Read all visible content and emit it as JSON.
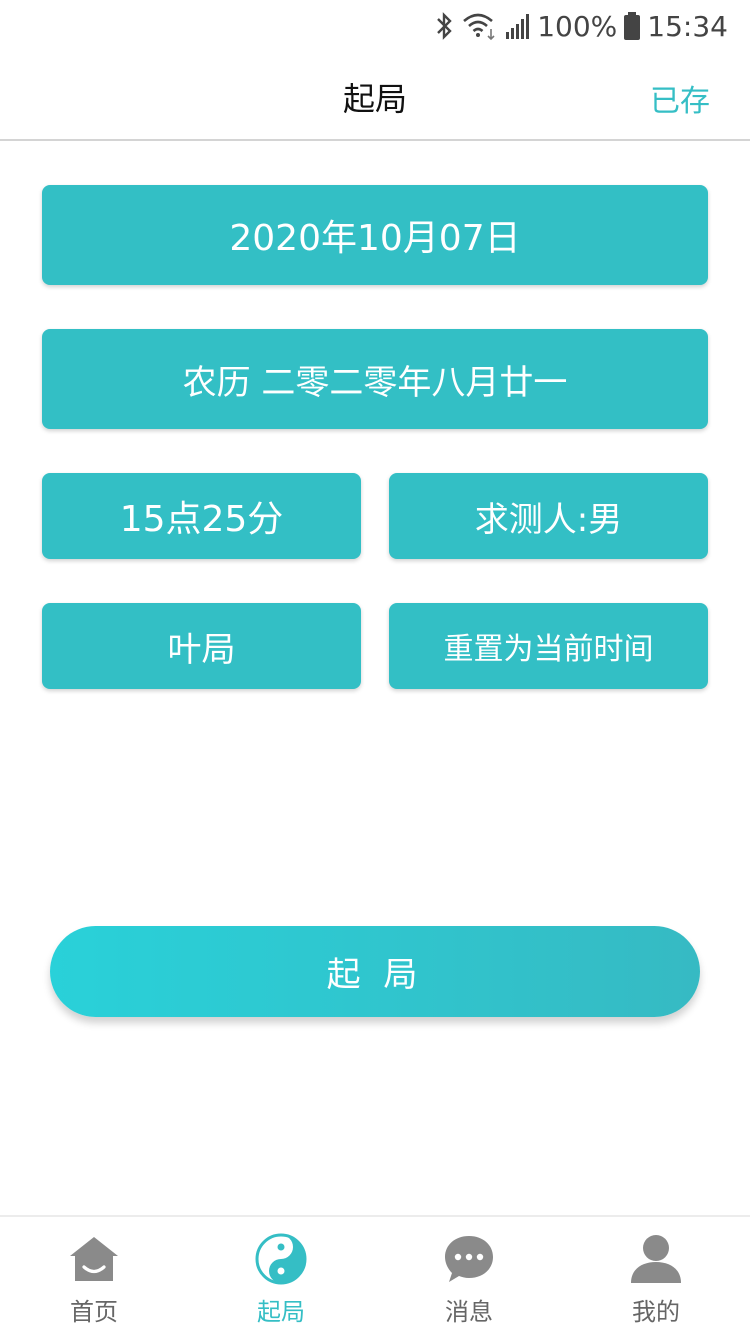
{
  "status_bar": {
    "battery_text": "100%",
    "time": "15:34",
    "icons": [
      "bluetooth-icon",
      "wifi-icon",
      "signal-icon",
      "battery-icon"
    ]
  },
  "header": {
    "title": "起局",
    "action_label": "已存"
  },
  "cards": {
    "date": "2020年10月07日",
    "lunar": "农历 二零二零年八月廿一",
    "time": "15点25分",
    "person": "求测人:男",
    "method": "叶局",
    "reset": "重置为当前时间"
  },
  "start_button": "起 局",
  "tabs": [
    {
      "label": "首页",
      "icon": "home-icon",
      "active": false
    },
    {
      "label": "起局",
      "icon": "yin-yang-icon",
      "active": true
    },
    {
      "label": "消息",
      "icon": "chat-bubble-icon",
      "active": false
    },
    {
      "label": "我的",
      "icon": "user-icon",
      "active": false
    }
  ],
  "colors": {
    "accent": "#33bfc5",
    "tab_inactive": "#8a8a8a",
    "tab_active": "#35bec5"
  }
}
